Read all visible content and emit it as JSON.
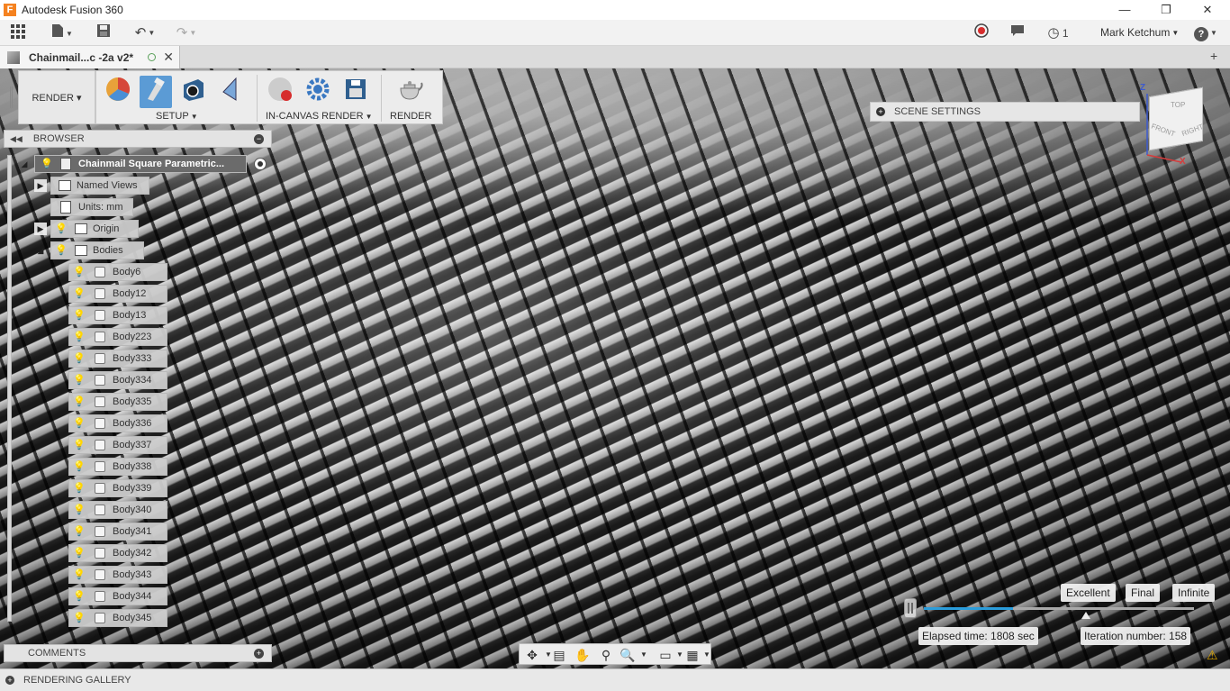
{
  "window": {
    "title": "Autodesk Fusion 360",
    "minimize": "—",
    "restore": "❐",
    "close": "✕"
  },
  "app_toolbar": {
    "user_name": "Mark Ketchum",
    "job_count": "1",
    "help": "?"
  },
  "document_tab": {
    "name": "Chainmail...c -2a v2*",
    "close": "✕"
  },
  "ribbon": {
    "mode_label": "RENDER ▾",
    "setup_label": "SETUP",
    "in_canvas_label": "IN-CANVAS RENDER",
    "render_label": "RENDER"
  },
  "scene_settings": {
    "label": "SCENE SETTINGS"
  },
  "viewcube": {
    "top": "TOP",
    "front": "FRONT",
    "right": "RIGHT",
    "z": "Z",
    "x": "X"
  },
  "browser": {
    "title": "BROWSER",
    "root": "Chainmail Square Parametric...",
    "named_views": "Named Views",
    "units": "Units: mm",
    "origin": "Origin",
    "bodies_folder": "Bodies",
    "bodies": [
      "Body6",
      "Body12",
      "Body13",
      "Body223",
      "Body333",
      "Body334",
      "Body335",
      "Body336",
      "Body337",
      "Body338",
      "Body339",
      "Body340",
      "Body341",
      "Body342",
      "Body343",
      "Body344",
      "Body345"
    ]
  },
  "comments": {
    "label": "COMMENTS"
  },
  "render_progress": {
    "quality_levels": [
      "Excellent",
      "Final",
      "Infinite"
    ],
    "progress_fraction": 0.33,
    "elapsed": "Elapsed time: 1808 sec",
    "iteration": "Iteration number: 158"
  },
  "gallery": {
    "label": "RENDERING GALLERY"
  },
  "colors": {
    "accent": "#2b9ddb",
    "bulb_on": "#f0c419",
    "bulb_off": "#7aa7d9",
    "brand": "#f58220"
  }
}
